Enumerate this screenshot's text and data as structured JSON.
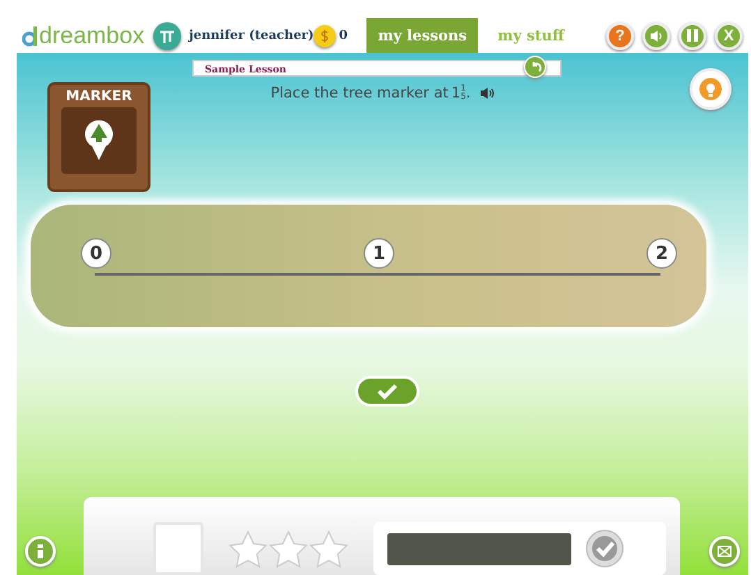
{
  "header": {
    "logo": "dreambox",
    "user": "jennifer (teacher)",
    "coins": "0",
    "tabs": [
      {
        "label": "my lessons",
        "selected": true
      },
      {
        "label": "my stuff",
        "selected": false
      }
    ],
    "controls": [
      {
        "kind": "help",
        "label": "?"
      },
      {
        "kind": "sound"
      },
      {
        "kind": "pause"
      },
      {
        "kind": "close",
        "label": "X"
      }
    ]
  },
  "lesson": {
    "title": "Sample Lesson",
    "prompt": "Place the tree marker at",
    "whole": "1",
    "numerator": "1",
    "denominator": "5",
    "end": "."
  },
  "marker_panel": {
    "title": "MARKER"
  },
  "number_line": {
    "ticks": [
      "0",
      "1",
      "2"
    ]
  },
  "footer": {
    "stars": 0
  }
}
